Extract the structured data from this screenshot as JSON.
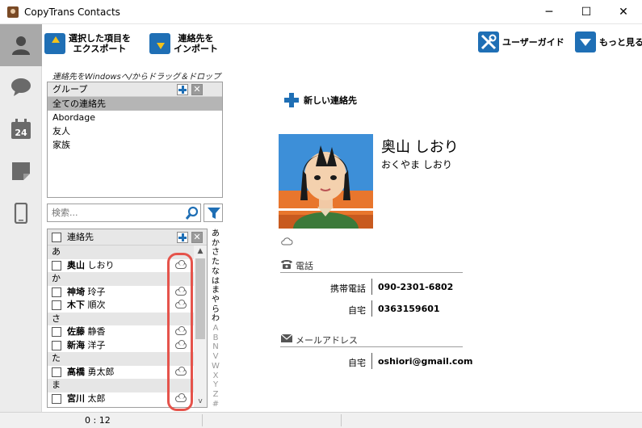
{
  "window": {
    "title": "CopyTrans Contacts",
    "minimize_glyph": "─",
    "maximize_glyph": "☐",
    "close_glyph": "✕"
  },
  "nav": {
    "items": [
      {
        "name": "contacts",
        "icon": "person-icon",
        "active": true
      },
      {
        "name": "messages",
        "icon": "chat-bubble-icon"
      },
      {
        "name": "calendar",
        "icon": "calendar-icon",
        "label": "24"
      },
      {
        "name": "notes",
        "icon": "note-icon"
      },
      {
        "name": "device",
        "icon": "phone-icon"
      }
    ]
  },
  "toolbar": {
    "export_line1": "選択した項目を",
    "export_line2": "エクスポート",
    "import_line1": "連絡先を",
    "import_line2": "インポート",
    "guide_label": "ユーザーガイド",
    "more_label": "もっと見る"
  },
  "hint": "連絡先をWindowsへ/からドラッグ＆ドロップ",
  "groups": {
    "header": "グループ",
    "items": [
      "全ての連絡先",
      "Abordage",
      "友人",
      "家族"
    ],
    "selected_index": 0
  },
  "search": {
    "placeholder": "検索..."
  },
  "contacts_list": {
    "header": "連絡先",
    "rows": [
      {
        "type": "section",
        "label": "あ"
      },
      {
        "type": "contact",
        "bold": "奥山",
        "rest": " しおり"
      },
      {
        "type": "section",
        "label": "か"
      },
      {
        "type": "contact",
        "bold": "神埼",
        "rest": " 玲子"
      },
      {
        "type": "contact",
        "bold": "木下",
        "rest": " 順次"
      },
      {
        "type": "section",
        "label": "さ"
      },
      {
        "type": "contact",
        "bold": "佐藤",
        "rest": " 静香"
      },
      {
        "type": "contact",
        "bold": "新海",
        "rest": " 洋子"
      },
      {
        "type": "section",
        "label": "た"
      },
      {
        "type": "contact",
        "bold": "高橋",
        "rest": " 勇太郎"
      },
      {
        "type": "section",
        "label": "ま"
      },
      {
        "type": "contact",
        "bold": "宮川",
        "rest": " 太郎"
      }
    ],
    "scroll_up": "▲",
    "scroll_down": "v"
  },
  "alpha_index": {
    "kana": [
      "あ",
      "か",
      "さ",
      "た",
      "な",
      "は",
      "ま",
      "や",
      "ら",
      "わ"
    ],
    "latin": [
      "A",
      "B",
      "N",
      "V",
      "W",
      "X",
      "Y",
      "Z",
      "#"
    ]
  },
  "new_contact_label": "新しい連絡先",
  "contact_detail": {
    "name": "奥山 しおり",
    "reading": "おくやま しおり",
    "phone_section": "電話",
    "phones": [
      {
        "label": "携帯電話",
        "value": "090-2301-6802"
      },
      {
        "label": "自宅",
        "value": "0363159601"
      }
    ],
    "email_section": "メールアドレス",
    "emails": [
      {
        "label": "自宅",
        "value": "oshiori@gmail.com"
      }
    ]
  },
  "status": {
    "text": "0 : 12"
  },
  "colors": {
    "accent": "#1f6fb5",
    "highlight": "#e5534b",
    "selected_group": "#b5b5b5",
    "nav_active": "#a9a9a9"
  }
}
